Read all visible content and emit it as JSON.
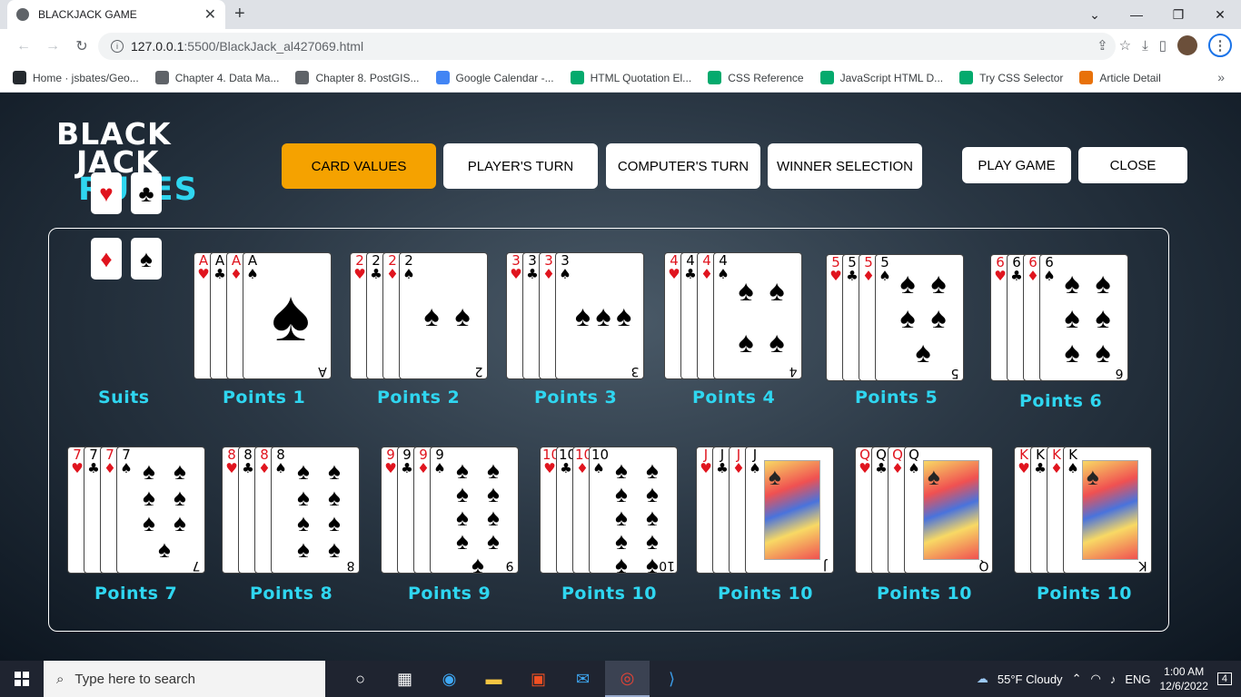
{
  "browser": {
    "tab_title": "BLACKJACK GAME",
    "url_host": "127.0.0.1",
    "url_path": ":5500/BlackJack_al427069.html",
    "bookmarks": [
      {
        "label": "Home · jsbates/Geo...",
        "icon": "github-icon",
        "color": "#24292e"
      },
      {
        "label": "Chapter 4. Data Ma...",
        "icon": "globe-icon",
        "color": "#5f6368"
      },
      {
        "label": "Chapter 8. PostGIS...",
        "icon": "globe-icon",
        "color": "#5f6368"
      },
      {
        "label": "Google Calendar -...",
        "icon": "calendar-icon",
        "color": "#4285f4"
      },
      {
        "label": "HTML Quotation El...",
        "icon": "w3schools-icon",
        "color": "#04aa6d"
      },
      {
        "label": "CSS Reference",
        "icon": "w3schools-icon",
        "color": "#04aa6d"
      },
      {
        "label": "JavaScript HTML D...",
        "icon": "w3schools-icon",
        "color": "#04aa6d"
      },
      {
        "label": "Try CSS Selector",
        "icon": "w3schools-icon",
        "color": "#04aa6d"
      },
      {
        "label": "Article Detail",
        "icon": "article-icon",
        "color": "#e8710a"
      }
    ]
  },
  "logo": {
    "line1": "BLACK",
    "line2": "JACK",
    "line3": "RULES"
  },
  "buttons": {
    "card_values": "CARD VALUES",
    "players_turn": "PLAYER'S TURN",
    "computers_turn": "COMPUTER'S TURN",
    "winner_selection": "WINNER SELECTION",
    "play_game": "PLAY GAME",
    "close": "CLOSE"
  },
  "colors": {
    "accent": "#f5a200",
    "label": "#2fd6f0",
    "red_suit": "#e0141e"
  },
  "suits_label": "Suits",
  "cards": [
    {
      "rank": "A",
      "label": "Points 1"
    },
    {
      "rank": "2",
      "label": "Points 2"
    },
    {
      "rank": "3",
      "label": "Points 3"
    },
    {
      "rank": "4",
      "label": "Points 4"
    },
    {
      "rank": "5",
      "label": "Points 5"
    },
    {
      "rank": "6",
      "label": "Points 6"
    },
    {
      "rank": "7",
      "label": "Points 7"
    },
    {
      "rank": "8",
      "label": "Points 8"
    },
    {
      "rank": "9",
      "label": "Points 9"
    },
    {
      "rank": "10",
      "label": "Points 10"
    },
    {
      "rank": "J",
      "label": "Points 10"
    },
    {
      "rank": "Q",
      "label": "Points 10"
    },
    {
      "rank": "K",
      "label": "Points 10"
    }
  ],
  "taskbar": {
    "search_placeholder": "Type here to search",
    "weather": "55°F  Cloudy",
    "language": "ENG",
    "time": "1:00 AM",
    "date": "12/6/2022",
    "notifications": "4"
  }
}
